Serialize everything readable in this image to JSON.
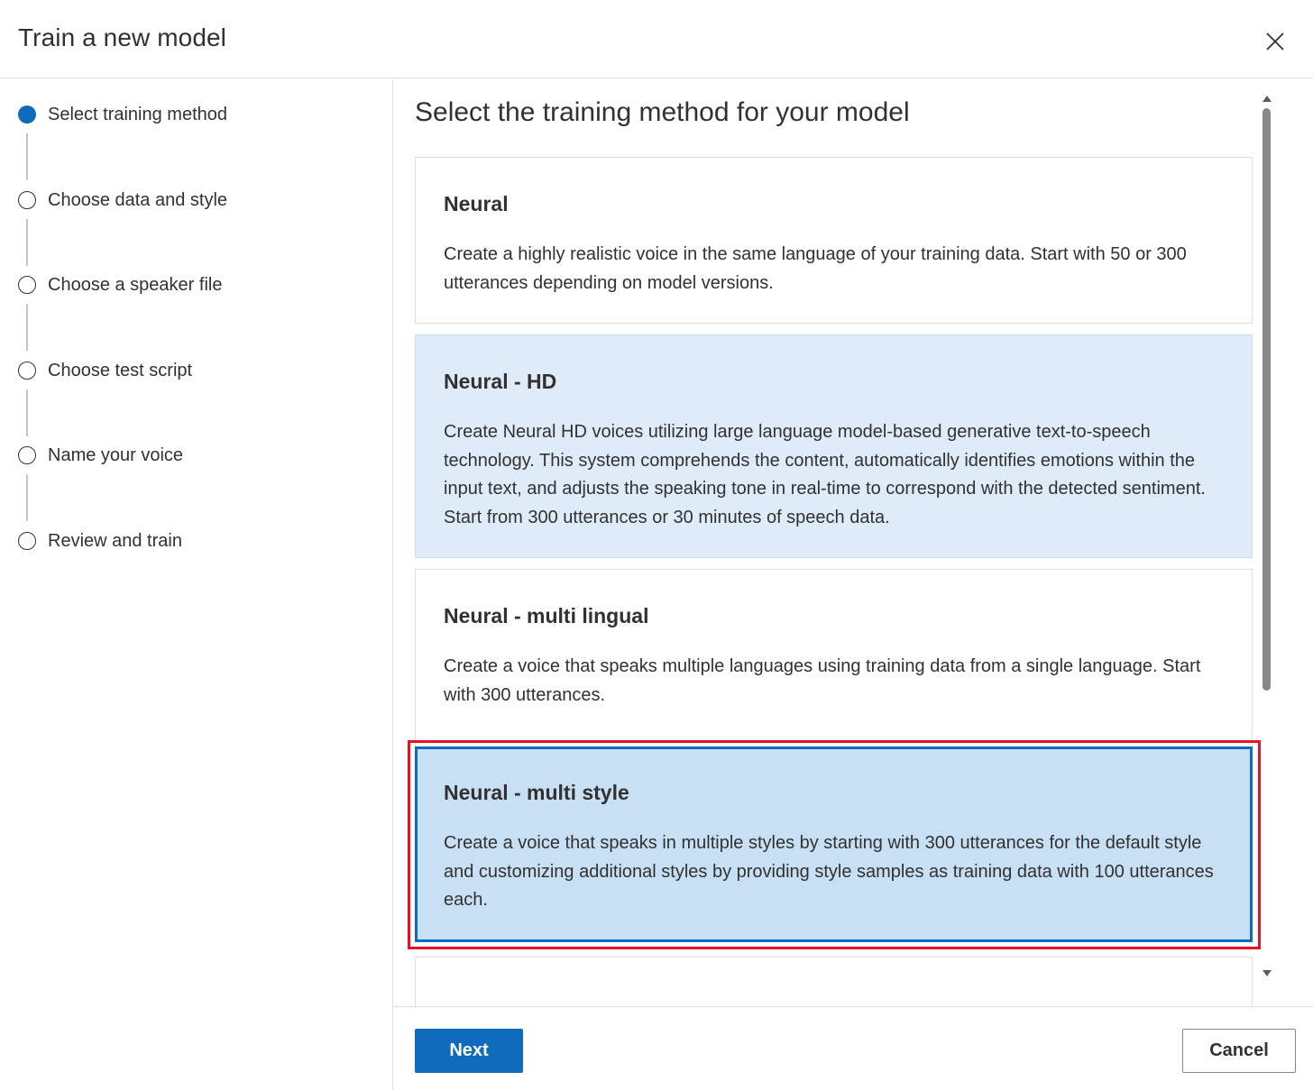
{
  "dialog": {
    "title": "Train a new model",
    "close_icon": "close-icon"
  },
  "steps": [
    {
      "label": "Select training method",
      "active": true
    },
    {
      "label": "Choose data and style",
      "active": false
    },
    {
      "label": "Choose a speaker file",
      "active": false
    },
    {
      "label": "Choose test script",
      "active": false
    },
    {
      "label": "Name your voice",
      "active": false
    },
    {
      "label": "Review and train",
      "active": false
    }
  ],
  "main": {
    "section_title": "Select the training method for your model",
    "cards": [
      {
        "title": "Neural",
        "description": "Create a highly realistic voice in the same language of your training data. Start with 50 or 300 utterances depending on model versions."
      },
      {
        "title": "Neural - HD",
        "description": "Create Neural HD voices utilizing large language model-based generative text-to-speech technology. This system comprehends the content, automatically identifies emotions within the input text, and adjusts the speaking tone in real-time to correspond with the detected sentiment. Start from 300 utterances or 30 minutes of speech data."
      },
      {
        "title": "Neural - multi lingual",
        "description": "Create a voice that speaks multiple languages using training data from a single language. Start with 300 utterances."
      },
      {
        "title": "Neural - multi style",
        "description": "Create a voice that speaks in multiple styles by starting with 300 utterances for the default style and customizing additional styles by providing style samples as training data with 100 utterances each.",
        "selected": true
      }
    ]
  },
  "footer": {
    "next_label": "Next",
    "cancel_label": "Cancel"
  },
  "colors": {
    "accent": "#0f6cbd",
    "selected_card_bg": "#c7e0f4",
    "hd_card_bg": "#deecf9",
    "highlight_border": "#e81123"
  }
}
